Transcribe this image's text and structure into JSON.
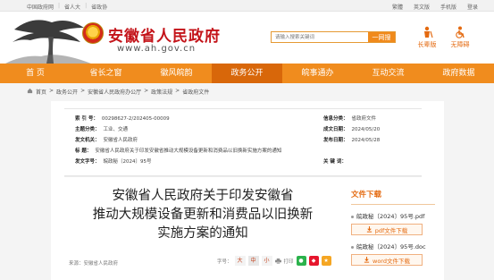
{
  "topbar": {
    "left_links": [
      "中国政府网",
      "省人大",
      "省政协"
    ],
    "right_links": [
      "繁體",
      "英文版",
      "手机版",
      "登录"
    ]
  },
  "header": {
    "site_title": "安徽省人民政府",
    "site_url": "www.ah.gov.cn",
    "search_placeholder": "请输入搜索关键词",
    "search_button": "一网搜",
    "quick_links": [
      {
        "label": "长辈版",
        "icon": "elder-icon"
      },
      {
        "label": "无障碍",
        "icon": "accessibility-icon"
      }
    ]
  },
  "nav": {
    "items": [
      "首  页",
      "省长之窗",
      "徽风皖韵",
      "政务公开",
      "皖事通办",
      "互动交流",
      "政府数据"
    ],
    "active_index": 3
  },
  "breadcrumb": [
    "首页",
    "政务公开",
    "安徽省人民政府办公厅",
    "政策法规",
    "省政府文件"
  ],
  "meta": {
    "index_label": "索 引 号：",
    "index_value": "00298627-2/202405-00009",
    "category_label": "信息分类：",
    "category_value": "省政府文件",
    "topic_label": "主题分类：",
    "topic_value": "工业、交通",
    "date_label": "成文日期：",
    "date_value": "2024/05/20",
    "issuer_label": "发文机关：",
    "issuer_value": "安徽省人民政府",
    "publish_label": "发布日期：",
    "publish_value": "2024/05/28",
    "title_label": "标    题：",
    "title_value": "安徽省人民政府关于印发安徽省推动大规模设备更新和消费品以旧换新实施方案的通知",
    "docno_label": "发文字号：",
    "docno_value": "皖政秘〔2024〕95号",
    "keyword_label": "关 键 词：",
    "keyword_value": ""
  },
  "document": {
    "title_lines": [
      "安徽省人民政府关于印发安徽省",
      "推动大规模设备更新和消费品以旧换新",
      "实施方案的通知"
    ],
    "source": "来源：安徽省人民政府",
    "font_size_label": "字号：",
    "font_sizes": [
      "大",
      "中",
      "小"
    ],
    "print_label": "打印"
  },
  "downloads": {
    "title": "文件下载",
    "files": [
      {
        "name": "皖政秘〔2024〕95号.pdf",
        "button": "pdf文件下载"
      },
      {
        "name": "皖政秘〔2024〕95号.doc",
        "button": "word文件下载"
      }
    ]
  },
  "colors": {
    "nav_orange": "#f08c1e",
    "nav_active": "#d8670a",
    "title_red": "#c4141a",
    "accent": "#e46a10"
  }
}
